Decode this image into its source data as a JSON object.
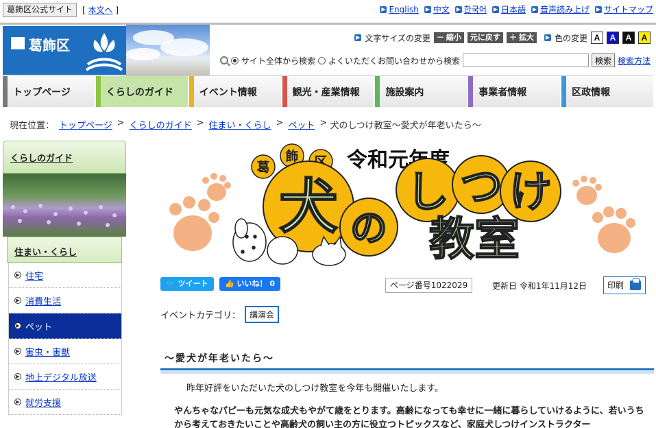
{
  "topbar": {
    "official_badge": "葛飾区公式サイト",
    "skip_prefix": "[",
    "skip_label": "本文へ",
    "skip_suffix": "]",
    "languages": [
      "English",
      "中文",
      "한국어",
      "日本語",
      "音声読み上げ",
      "サイトマップ"
    ]
  },
  "header": {
    "logo_text": "葛飾区",
    "textsize_label": "文字サイズの変更",
    "shrink_label": "－ 縮小",
    "reset_label": "元に戻す",
    "enlarge_label": "＋ 拡大",
    "color_label": "色の変更",
    "color_options": [
      "A",
      "A",
      "A",
      "A"
    ],
    "search_site_label": "サイト全体から検索",
    "search_faq_label": "よくいただくお問い合わせから検索",
    "search_value": "",
    "search_button": "検索",
    "search_help": "検索方法"
  },
  "gnav": {
    "items": [
      {
        "label": "トップページ",
        "color": "#7a7a7a"
      },
      {
        "label": "くらしのガイド",
        "color": "#8cc63f"
      },
      {
        "label": "イベント情報",
        "color": "#e6b422"
      },
      {
        "label": "観光・産業情報",
        "color": "#d9534f"
      },
      {
        "label": "施設案内",
        "color": "#5cb85c"
      },
      {
        "label": "事業者情報",
        "color": "#8e6bc6"
      },
      {
        "label": "区政情報",
        "color": "#3a9ad9"
      }
    ]
  },
  "breadcrumb": {
    "label": "現在位置：",
    "links": [
      "トップページ",
      "くらしのガイド",
      "住まい・くらし",
      "ペット"
    ],
    "sep": ">",
    "current": "犬のしつけ教室～愛犬が年老いたら～"
  },
  "sidebar": {
    "heading": "くらしのガイド",
    "subheading": "住まい・くらし",
    "items": [
      "住宅",
      "消費生活",
      "ペット",
      "害虫・害獣",
      "地上デジタル放送",
      "就労支援"
    ]
  },
  "banner": {
    "title_ward": [
      "葛",
      "飾",
      "区"
    ],
    "title_year": "令和元年度",
    "title_main": [
      "犬",
      "の",
      "し",
      "つ",
      "け"
    ],
    "title_class": "教室"
  },
  "meta": {
    "tweet": "ツイート",
    "like": "いいね！ 0",
    "page_number": "ページ番号1022029",
    "updated": "更新日 令和1年11月12日",
    "print": "印刷"
  },
  "category": {
    "label": "イベントカテゴリ：",
    "tag": "講演会"
  },
  "content": {
    "heading": "～愛犬が年老いたら～",
    "intro": "昨年好評をいただいた犬のしつけ教室を今年も開催いたします。",
    "body": "やんちゃなパピーも元気な成犬もやがて歳をとります。高齢になっても幸せに一緒に暮らしていけるように、若いうちから考えておきたいことや高齢犬の飼い主の方に役立つトピックスなど、家庭犬しつけインストラクター"
  },
  "colors": {
    "brand_blue": "#1f6fc0",
    "current_nav": "#0b2f9a",
    "banner_yellow": "#f6b80c",
    "paw": "#f4b183",
    "title_green": "#c7e6b0"
  }
}
